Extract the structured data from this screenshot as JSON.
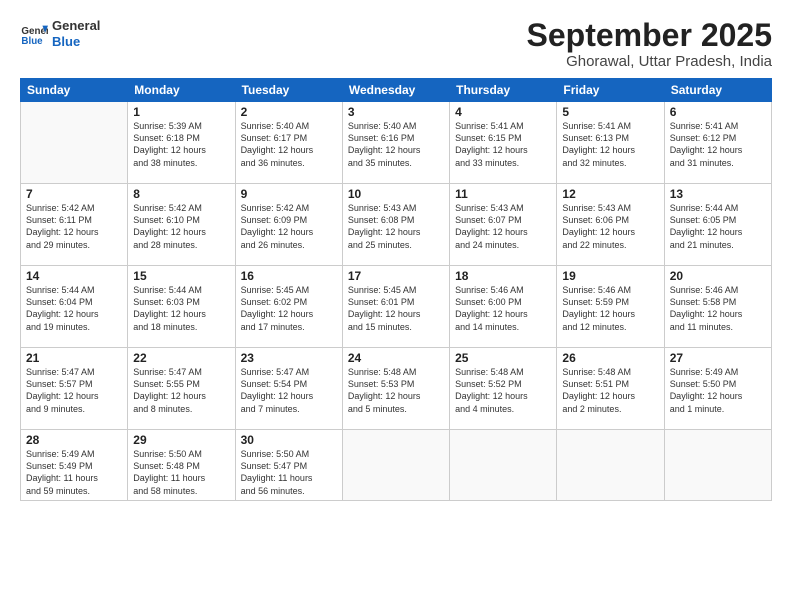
{
  "logo": {
    "general": "General",
    "blue": "Blue"
  },
  "title": "September 2025",
  "subtitle": "Ghorawal, Uttar Pradesh, India",
  "days_of_week": [
    "Sunday",
    "Monday",
    "Tuesday",
    "Wednesday",
    "Thursday",
    "Friday",
    "Saturday"
  ],
  "weeks": [
    [
      {
        "day": "",
        "info": ""
      },
      {
        "day": "1",
        "info": "Sunrise: 5:39 AM\nSunset: 6:18 PM\nDaylight: 12 hours\nand 38 minutes."
      },
      {
        "day": "2",
        "info": "Sunrise: 5:40 AM\nSunset: 6:17 PM\nDaylight: 12 hours\nand 36 minutes."
      },
      {
        "day": "3",
        "info": "Sunrise: 5:40 AM\nSunset: 6:16 PM\nDaylight: 12 hours\nand 35 minutes."
      },
      {
        "day": "4",
        "info": "Sunrise: 5:41 AM\nSunset: 6:15 PM\nDaylight: 12 hours\nand 33 minutes."
      },
      {
        "day": "5",
        "info": "Sunrise: 5:41 AM\nSunset: 6:13 PM\nDaylight: 12 hours\nand 32 minutes."
      },
      {
        "day": "6",
        "info": "Sunrise: 5:41 AM\nSunset: 6:12 PM\nDaylight: 12 hours\nand 31 minutes."
      }
    ],
    [
      {
        "day": "7",
        "info": "Sunrise: 5:42 AM\nSunset: 6:11 PM\nDaylight: 12 hours\nand 29 minutes."
      },
      {
        "day": "8",
        "info": "Sunrise: 5:42 AM\nSunset: 6:10 PM\nDaylight: 12 hours\nand 28 minutes."
      },
      {
        "day": "9",
        "info": "Sunrise: 5:42 AM\nSunset: 6:09 PM\nDaylight: 12 hours\nand 26 minutes."
      },
      {
        "day": "10",
        "info": "Sunrise: 5:43 AM\nSunset: 6:08 PM\nDaylight: 12 hours\nand 25 minutes."
      },
      {
        "day": "11",
        "info": "Sunrise: 5:43 AM\nSunset: 6:07 PM\nDaylight: 12 hours\nand 24 minutes."
      },
      {
        "day": "12",
        "info": "Sunrise: 5:43 AM\nSunset: 6:06 PM\nDaylight: 12 hours\nand 22 minutes."
      },
      {
        "day": "13",
        "info": "Sunrise: 5:44 AM\nSunset: 6:05 PM\nDaylight: 12 hours\nand 21 minutes."
      }
    ],
    [
      {
        "day": "14",
        "info": "Sunrise: 5:44 AM\nSunset: 6:04 PM\nDaylight: 12 hours\nand 19 minutes."
      },
      {
        "day": "15",
        "info": "Sunrise: 5:44 AM\nSunset: 6:03 PM\nDaylight: 12 hours\nand 18 minutes."
      },
      {
        "day": "16",
        "info": "Sunrise: 5:45 AM\nSunset: 6:02 PM\nDaylight: 12 hours\nand 17 minutes."
      },
      {
        "day": "17",
        "info": "Sunrise: 5:45 AM\nSunset: 6:01 PM\nDaylight: 12 hours\nand 15 minutes."
      },
      {
        "day": "18",
        "info": "Sunrise: 5:46 AM\nSunset: 6:00 PM\nDaylight: 12 hours\nand 14 minutes."
      },
      {
        "day": "19",
        "info": "Sunrise: 5:46 AM\nSunset: 5:59 PM\nDaylight: 12 hours\nand 12 minutes."
      },
      {
        "day": "20",
        "info": "Sunrise: 5:46 AM\nSunset: 5:58 PM\nDaylight: 12 hours\nand 11 minutes."
      }
    ],
    [
      {
        "day": "21",
        "info": "Sunrise: 5:47 AM\nSunset: 5:57 PM\nDaylight: 12 hours\nand 9 minutes."
      },
      {
        "day": "22",
        "info": "Sunrise: 5:47 AM\nSunset: 5:55 PM\nDaylight: 12 hours\nand 8 minutes."
      },
      {
        "day": "23",
        "info": "Sunrise: 5:47 AM\nSunset: 5:54 PM\nDaylight: 12 hours\nand 7 minutes."
      },
      {
        "day": "24",
        "info": "Sunrise: 5:48 AM\nSunset: 5:53 PM\nDaylight: 12 hours\nand 5 minutes."
      },
      {
        "day": "25",
        "info": "Sunrise: 5:48 AM\nSunset: 5:52 PM\nDaylight: 12 hours\nand 4 minutes."
      },
      {
        "day": "26",
        "info": "Sunrise: 5:48 AM\nSunset: 5:51 PM\nDaylight: 12 hours\nand 2 minutes."
      },
      {
        "day": "27",
        "info": "Sunrise: 5:49 AM\nSunset: 5:50 PM\nDaylight: 12 hours\nand 1 minute."
      }
    ],
    [
      {
        "day": "28",
        "info": "Sunrise: 5:49 AM\nSunset: 5:49 PM\nDaylight: 11 hours\nand 59 minutes."
      },
      {
        "day": "29",
        "info": "Sunrise: 5:50 AM\nSunset: 5:48 PM\nDaylight: 11 hours\nand 58 minutes."
      },
      {
        "day": "30",
        "info": "Sunrise: 5:50 AM\nSunset: 5:47 PM\nDaylight: 11 hours\nand 56 minutes."
      },
      {
        "day": "",
        "info": ""
      },
      {
        "day": "",
        "info": ""
      },
      {
        "day": "",
        "info": ""
      },
      {
        "day": "",
        "info": ""
      }
    ]
  ]
}
